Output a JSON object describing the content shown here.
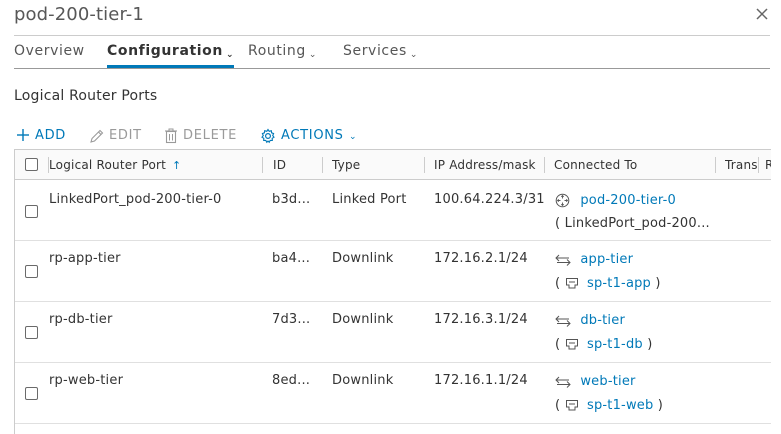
{
  "header": {
    "title": "pod-200-tier-1"
  },
  "tabs": [
    {
      "label": "Overview",
      "has_menu": false
    },
    {
      "label": "Configuration",
      "has_menu": true
    },
    {
      "label": "Routing",
      "has_menu": true
    },
    {
      "label": "Services",
      "has_menu": true
    }
  ],
  "active_tab": "Configuration",
  "section": {
    "title": "Logical Router Ports"
  },
  "toolbar": {
    "add": "ADD",
    "edit": "EDIT",
    "delete": "DELETE",
    "actions": "ACTIONS"
  },
  "colors": {
    "accent": "#0079b8",
    "disabled": "#9a9a9a",
    "border": "#cccccc"
  },
  "table": {
    "columns": [
      "Logical Router Port",
      "ID",
      "Type",
      "IP Address/mask",
      "Connected To",
      "Transport Zone",
      "R"
    ],
    "sort_column": "Logical Router Port",
    "sort_direction": "ascending",
    "rows": [
      {
        "name": "LinkedPort_pod-200-tier-0",
        "id": "b3d...",
        "type": "Linked Port",
        "ip": "100.64.224.3/31",
        "connected_icon": "router-icon",
        "connected_to": "pod-200-tier-0",
        "sub_open": "(",
        "sub_text": "LinkedPort_pod-200...",
        "sub_close": ""
      },
      {
        "name": "rp-app-tier",
        "id": "ba4...",
        "type": "Downlink",
        "ip": "172.16.2.1/24",
        "connected_icon": "switch-arrows-icon",
        "connected_to": "app-tier",
        "sub_open": "(",
        "sub_icon": "port-icon",
        "sub_text": "sp-t1-app",
        "sub_close": ")"
      },
      {
        "name": "rp-db-tier",
        "id": "7d3...",
        "type": "Downlink",
        "ip": "172.16.3.1/24",
        "connected_icon": "switch-arrows-icon",
        "connected_to": "db-tier",
        "sub_open": "(",
        "sub_icon": "port-icon",
        "sub_text": "sp-t1-db",
        "sub_close": ")"
      },
      {
        "name": "rp-web-tier",
        "id": "8ed...",
        "type": "Downlink",
        "ip": "172.16.1.1/24",
        "connected_icon": "switch-arrows-icon",
        "connected_to": "web-tier",
        "sub_open": "(",
        "sub_icon": "port-icon",
        "sub_text": "sp-t1-web",
        "sub_close": ")"
      }
    ]
  }
}
